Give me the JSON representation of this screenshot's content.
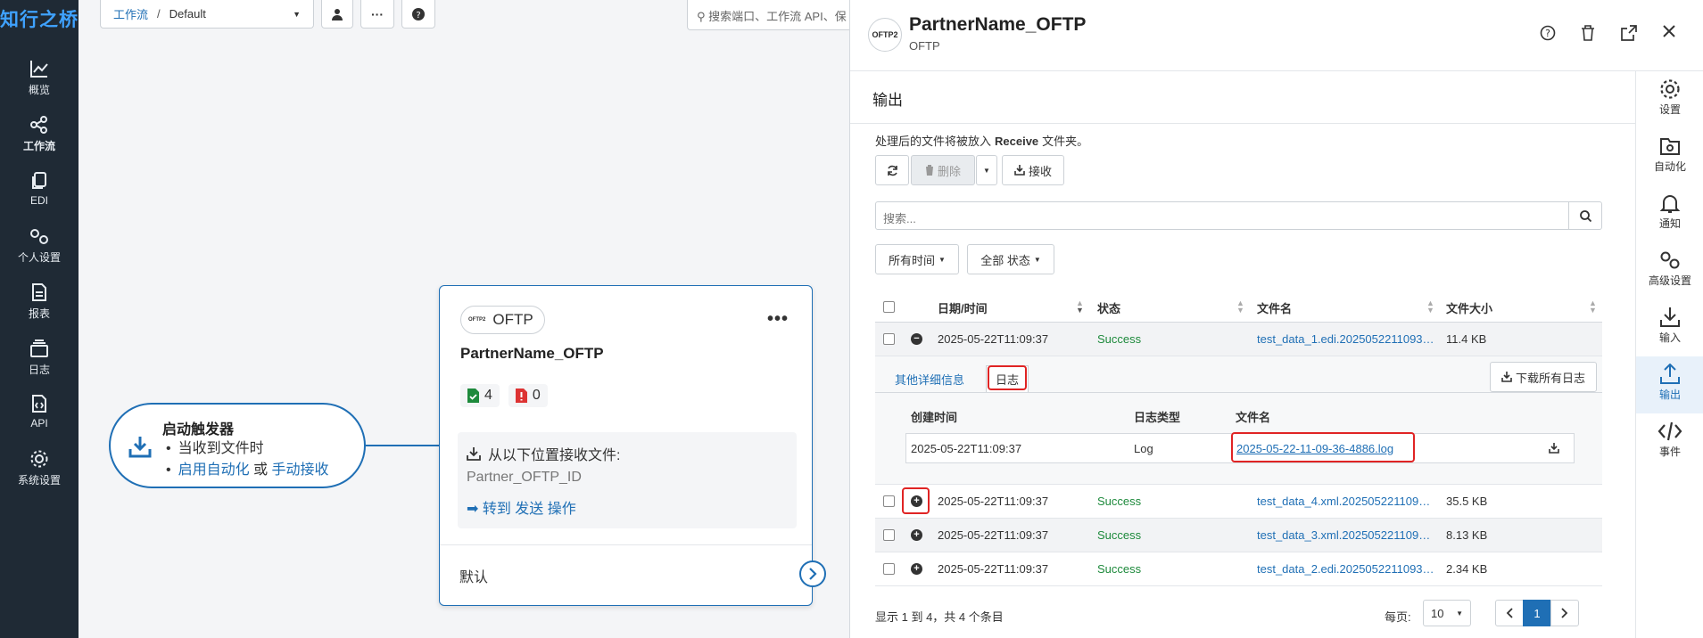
{
  "nav": {
    "logo": "知行之桥",
    "items": [
      {
        "label": "概览",
        "icon": "chart-line-icon"
      },
      {
        "label": "工作流",
        "icon": "share-nodes-icon"
      },
      {
        "label": "EDI",
        "icon": "copy-icon"
      },
      {
        "label": "个人设置",
        "icon": "gears-icon"
      },
      {
        "label": "报表",
        "icon": "file-report-icon"
      },
      {
        "label": "日志",
        "icon": "layers-icon"
      },
      {
        "label": "API",
        "icon": "file-code-icon"
      },
      {
        "label": "系统设置",
        "icon": "gear-icon"
      }
    ],
    "active": "工作流"
  },
  "toolbar": {
    "crumb_root": "工作流",
    "crumb_sep": "/",
    "crumb_current": "Default",
    "search_placeholder": "搜索端口、工作流 API、保"
  },
  "trigger": {
    "title": "启动触发器",
    "line1": "当收到文件时",
    "auto_link": "启用自动化",
    "or_text": " 或 ",
    "manual_link": "手动接收"
  },
  "node": {
    "chip_mini": "OFTP2",
    "chip_label": "OFTP",
    "name": "PartnerName_OFTP",
    "success_count": "4",
    "error_count": "0",
    "receive_label": "从以下位置接收文件:",
    "receive_value": "Partner_OFTP_ID",
    "goto_text": "➡ 转到 发送 操作",
    "footer_label": "默认"
  },
  "panel": {
    "logo_text": "OFTP2",
    "title": "PartnerName_OFTP",
    "subtitle": "OFTP",
    "section_title": "输出",
    "info_prefix": "处理后的文件将被放入",
    "info_folder": "Receive",
    "info_suffix": "文件夹。",
    "btn_delete": "删除",
    "btn_receive": "接收",
    "search_placeholder": "搜索...",
    "filter_time": "所有时间",
    "filter_status": "全部 状态",
    "columns": {
      "datetime": "日期/时间",
      "status": "状态",
      "filename": "文件名",
      "size": "文件大小"
    },
    "rows": [
      {
        "datetime": "2025-05-22T11:09:37",
        "status": "Success",
        "filename": "test_data_1.edi.20250522110936...",
        "size": "11.4 KB"
      },
      {
        "datetime": "2025-05-22T11:09:37",
        "status": "Success",
        "filename": "test_data_4.xml.20250522110936...",
        "size": "35.5 KB"
      },
      {
        "datetime": "2025-05-22T11:09:37",
        "status": "Success",
        "filename": "test_data_3.xml.20250522110936...",
        "size": "8.13 KB"
      },
      {
        "datetime": "2025-05-22T11:09:37",
        "status": "Success",
        "filename": "test_data_2.edi.20250522110936...",
        "size": "2.34 KB"
      }
    ],
    "detail": {
      "tab_other": "其他详细信息",
      "tab_log": "日志",
      "download_all": "下载所有日志",
      "col_created": "创建时间",
      "col_type": "日志类型",
      "col_filename": "文件名",
      "log_created": "2025-05-22T11:09:37",
      "log_type": "Log",
      "log_file": "2025-05-22-11-09-36-4886.log"
    },
    "pager": {
      "summary": "显示 1 到 4，共 4 个条目",
      "per_page_label": "每页:",
      "per_page_value": "10",
      "current_page": "1"
    },
    "rail": [
      {
        "label": "设置",
        "icon": "gear-icon"
      },
      {
        "label": "自动化",
        "icon": "folder-gear-icon"
      },
      {
        "label": "通知",
        "icon": "bell-icon"
      },
      {
        "label": "高级设置",
        "icon": "gears-icon"
      },
      {
        "label": "输入",
        "icon": "download-icon"
      },
      {
        "label": "输出",
        "icon": "upload-icon"
      },
      {
        "label": "事件",
        "icon": "code-icon"
      }
    ]
  },
  "colors": {
    "nav_bg": "#1f2a35",
    "accent": "#1f6fb5",
    "success": "#1e8a3c",
    "highlight": "#e02424"
  }
}
